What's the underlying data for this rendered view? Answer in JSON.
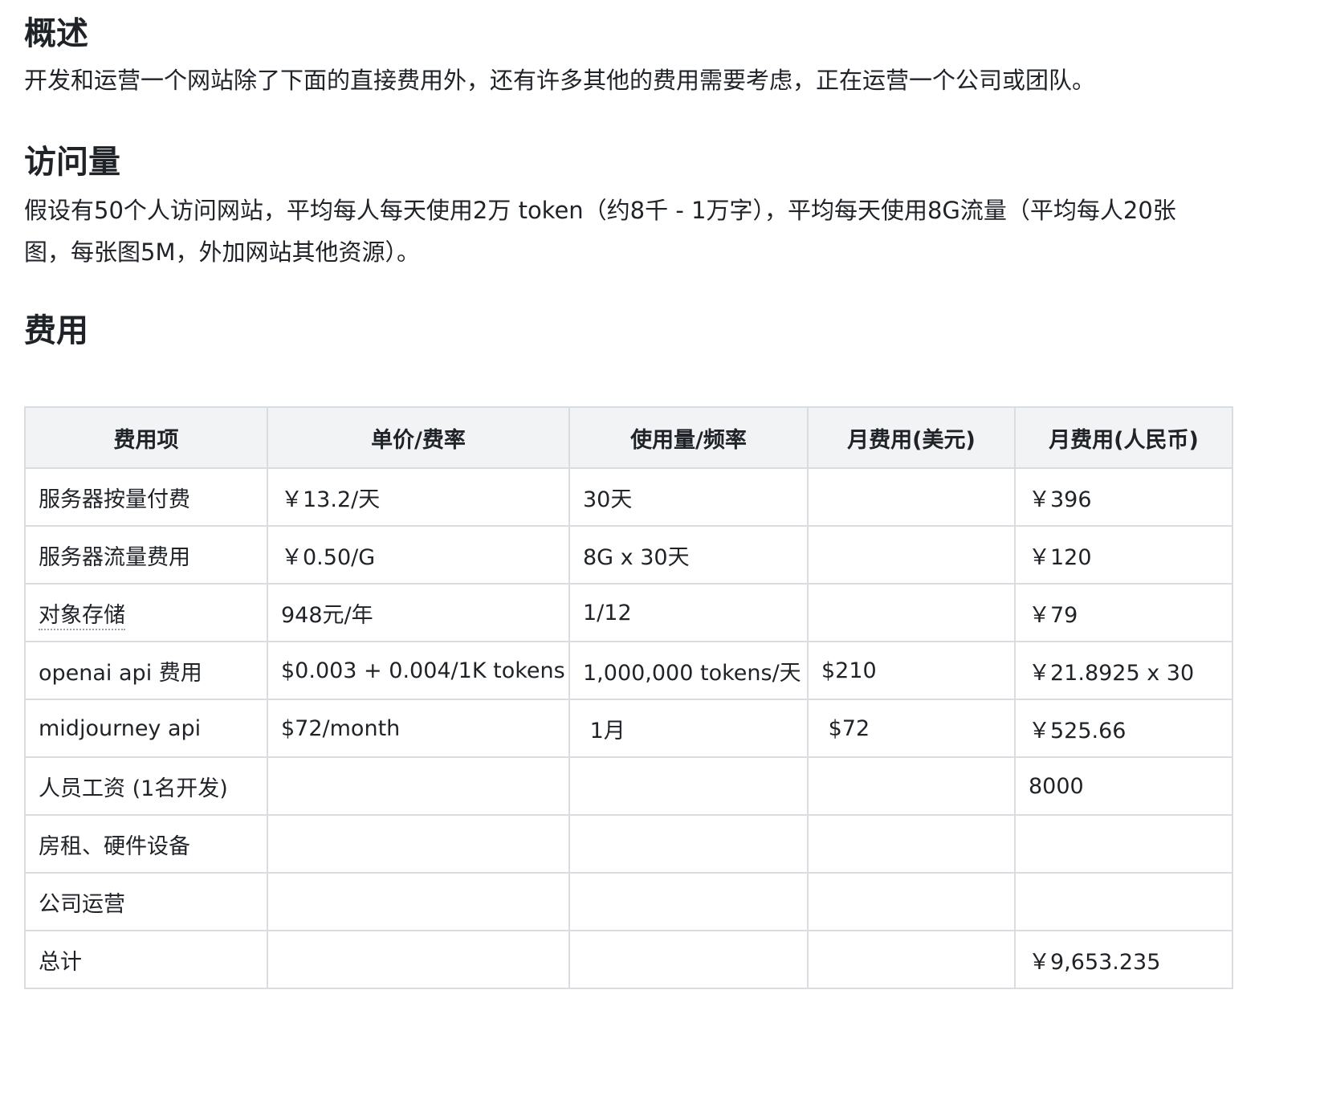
{
  "overview": {
    "title": "概述",
    "text": "开发和运营一个网站除了下面的直接费用外，还有许多其他的费用需要考虑，正在运营一个公司或团队。"
  },
  "traffic": {
    "title": "访问量",
    "line1": "假设有50个人访问网站，平均每人每天使用2万 token（约8千 - 1万字），平均每天使用8G流量（平均每人20张",
    "line2": "图，每张图5M，外加网站其他资源）。"
  },
  "costs": {
    "title": "费用",
    "headers": [
      "费用项",
      "单价/费率",
      "使用量/频率",
      "月费用(美元)",
      "月费用(人民币)"
    ],
    "rows": [
      [
        "服务器按量付费",
        "￥13.2/天",
        "30天",
        "",
        "￥396"
      ],
      [
        "服务器流量费用",
        "￥0.50/G",
        "8G x 30天",
        "",
        "￥120"
      ],
      [
        "对象存储",
        "948元/年",
        "1/12",
        "",
        "￥79"
      ],
      [
        "openai api 费用",
        "$0.003 + 0.004/1K tokens",
        "1,000,000 tokens/天",
        "$210",
        "￥21.8925 x 30"
      ],
      [
        "midjourney api",
        "$72/month",
        " 1月",
        " $72",
        "￥525.66"
      ],
      [
        "人员工资 (1名开发)",
        "",
        "",
        "",
        "8000"
      ],
      [
        "房租、硬件设备",
        "",
        "",
        "",
        ""
      ],
      [
        "公司运营",
        "",
        "",
        "",
        ""
      ],
      [
        "总计",
        "",
        "",
        "",
        "￥9,653.235"
      ]
    ]
  }
}
